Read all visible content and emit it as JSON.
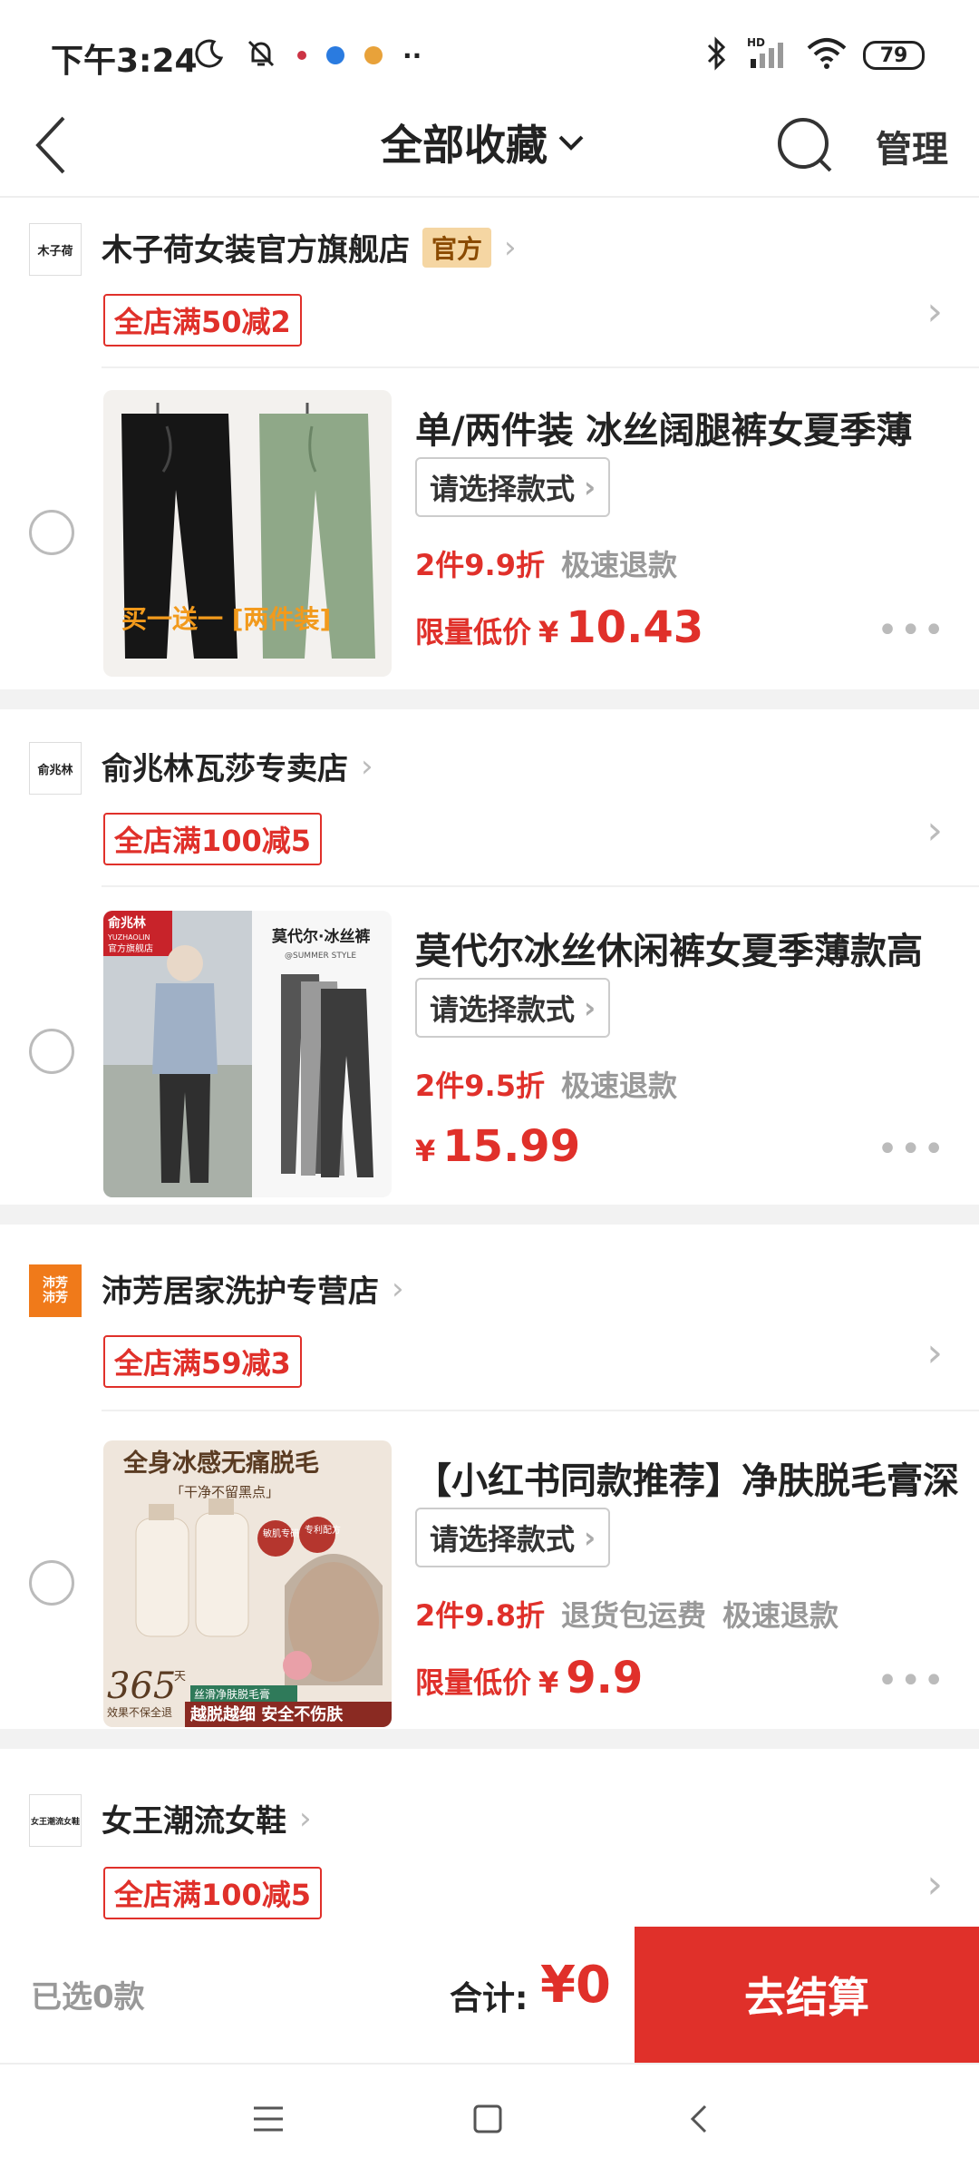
{
  "status": {
    "time": "下午3:24",
    "battery": "79"
  },
  "header": {
    "title": "全部收藏",
    "manage": "管理"
  },
  "stores": [
    {
      "name": "木子荷女装官方旗舰店",
      "logo_text": "木子荷",
      "official_badge": "官方",
      "coupon": "全店满50减2",
      "product": {
        "title": "单/两件装 冰丝阔腿裤女夏季薄",
        "style_label": "请选择款式",
        "tags": [
          "2件9.9折",
          "极速退款"
        ],
        "price_label": "限量低价",
        "currency": "¥",
        "price": "10.43",
        "image_caption": "买一送一 [两件装]"
      }
    },
    {
      "name": "俞兆林瓦莎专卖店",
      "logo_text": "俞兆林",
      "coupon": "全店满100减5",
      "product": {
        "title": "莫代尔冰丝休闲裤女夏季薄款高",
        "style_label": "请选择款式",
        "tags": [
          "2件9.5折",
          "极速退款"
        ],
        "price_label": "",
        "currency": "¥",
        "price": "15.99",
        "image_brand": "俞兆林",
        "image_brand_en": "YUZHAOLIN",
        "image_brand_sub": "官方旗舰店",
        "image_caption": "莫代尔·冰丝裤",
        "image_caption_en": "@SUMMER STYLE"
      }
    },
    {
      "name": "沛芳居家洗护专营店",
      "logo_text_1": "沛芳",
      "logo_text_2": "沛芳",
      "coupon": "全店满59减3",
      "product": {
        "title": "【小红书同款推荐】净肤脱毛膏深",
        "style_label": "请选择款式",
        "tags": [
          "2件9.8折",
          "退货包运费",
          "极速退款"
        ],
        "price_label": "限量低价",
        "currency": "¥",
        "price": "9.9",
        "image_headline": "全身冰感无痛脱毛",
        "image_sub": "「干净不留黑点」",
        "image_badge_1": "敏肌专研",
        "image_badge_2": "专利配方",
        "image_365": "365",
        "image_365_suffix": "天",
        "image_365_sub": "效果不保全退",
        "image_footer_tag": "丝滑净肤脱毛膏",
        "image_footer": "越脱越细 安全不伤肤"
      }
    },
    {
      "name": "女王潮流女鞋",
      "logo_text": "女王潮流女鞋",
      "coupon": "全店满100减5"
    }
  ],
  "bottom_bar": {
    "selected": "已选0款",
    "total_label": "合计:",
    "total_value": "¥0",
    "checkout": "去结算"
  },
  "colors": {
    "accent": "#e0302a",
    "official_badge_bg": "#f5d6a3"
  }
}
